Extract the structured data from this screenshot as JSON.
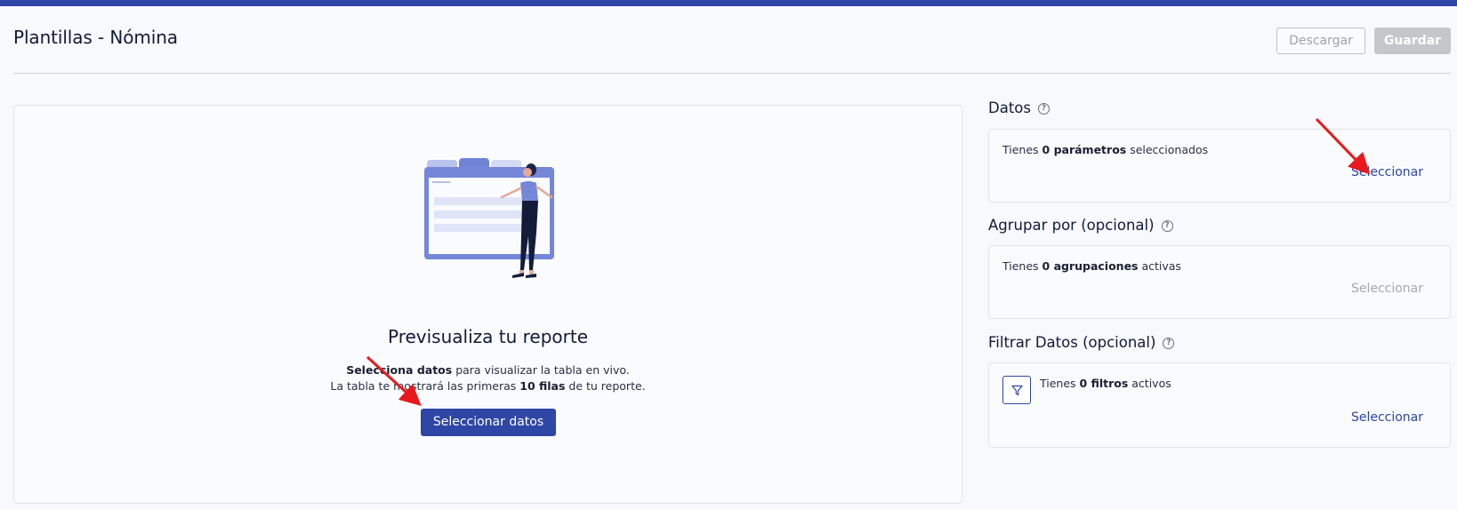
{
  "header": {
    "title": "Plantillas - Nómina",
    "download_label": "Descargar",
    "save_label": "Guardar"
  },
  "preview": {
    "title": "Previsualiza tu reporte",
    "line1_bold": "Selecciona datos",
    "line1_rest": " para visualizar la tabla en vivo.",
    "line2_pre": "La tabla te mostrará las primeras ",
    "line2_bold": "10 filas",
    "line2_post": " de tu reporte.",
    "button_label": "Seleccionar datos",
    "illustration_icon": "report-preview-illustration"
  },
  "sections": {
    "datos": {
      "title": "Datos",
      "text_pre": "Tienes ",
      "text_bold": "0 parámetros",
      "text_post": " seleccionados",
      "link_label": "Seleccionar"
    },
    "agrupar": {
      "title": "Agrupar por (opcional)",
      "text_pre": "Tienes ",
      "text_bold": "0 agrupaciones",
      "text_post": " activas",
      "link_label": "Seleccionar"
    },
    "filtrar": {
      "title": "Filtrar Datos (opcional)",
      "text_pre": "Tienes ",
      "text_bold": "0 filtros",
      "text_post": " activos",
      "link_label": "Seleccionar",
      "icon": "filter-icon"
    }
  },
  "help_glyph": "?",
  "colors": {
    "brand": "#2e46a6",
    "disabled_text": "#a5a8b0",
    "annotation_arrow": "#e8191c"
  }
}
